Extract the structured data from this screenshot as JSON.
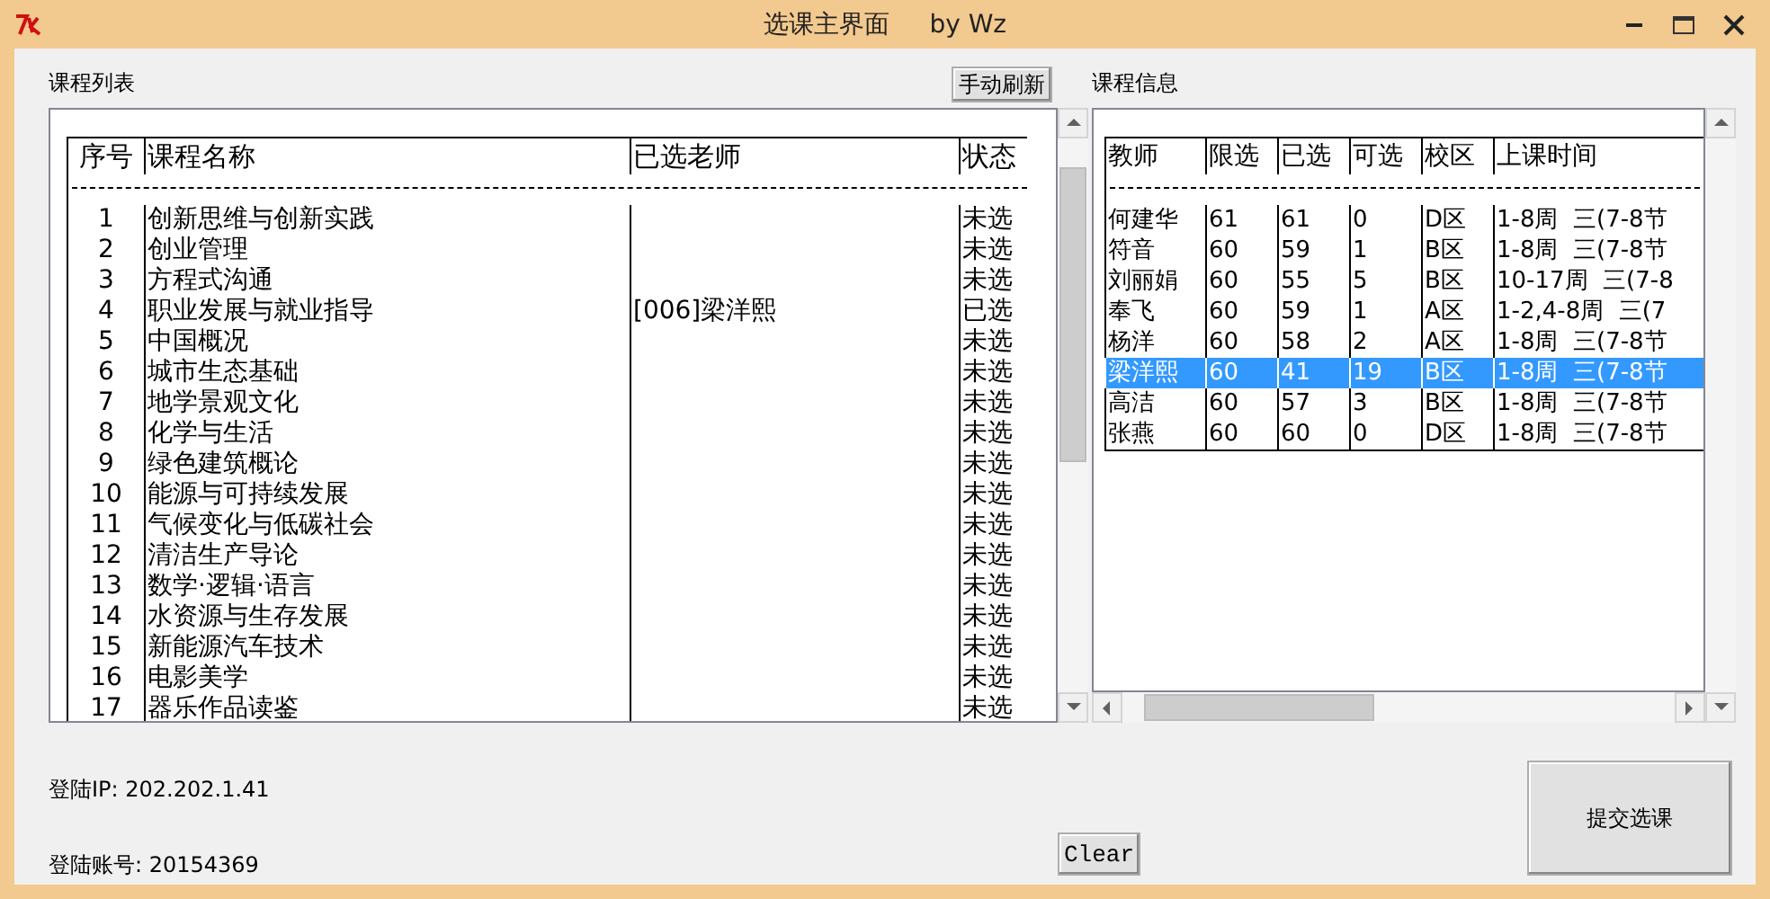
{
  "window": {
    "title": "选课主界面     by Wz"
  },
  "course_list": {
    "label": "课程列表",
    "refresh_button": "手动刷新",
    "columns": [
      "序号",
      "课程名称",
      "已选老师",
      "状态"
    ],
    "rows": [
      {
        "cells": [
          "1",
          "创新思维与创新实践",
          "",
          "未选"
        ]
      },
      {
        "cells": [
          "2",
          "创业管理",
          "",
          "未选"
        ]
      },
      {
        "cells": [
          "3",
          "方程式沟通",
          "",
          "未选"
        ]
      },
      {
        "cells": [
          "4",
          "职业发展与就业指导",
          "[006]梁洋熙",
          "已选"
        ]
      },
      {
        "cells": [
          "5",
          "中国概况",
          "",
          "未选"
        ]
      },
      {
        "cells": [
          "6",
          "城市生态基础",
          "",
          "未选"
        ]
      },
      {
        "cells": [
          "7",
          "地学景观文化",
          "",
          "未选"
        ]
      },
      {
        "cells": [
          "8",
          "化学与生活",
          "",
          "未选"
        ]
      },
      {
        "cells": [
          "9",
          "绿色建筑概论",
          "",
          "未选"
        ]
      },
      {
        "cells": [
          "10",
          "能源与可持续发展",
          "",
          "未选"
        ]
      },
      {
        "cells": [
          "11",
          "气候变化与低碳社会",
          "",
          "未选"
        ]
      },
      {
        "cells": [
          "12",
          "清洁生产导论",
          "",
          "未选"
        ]
      },
      {
        "cells": [
          "13",
          "数学·逻辑·语言",
          "",
          "未选"
        ]
      },
      {
        "cells": [
          "14",
          "水资源与生存发展",
          "",
          "未选"
        ]
      },
      {
        "cells": [
          "15",
          "新能源汽车技术",
          "",
          "未选"
        ]
      },
      {
        "cells": [
          "16",
          "电影美学",
          "",
          "未选"
        ]
      },
      {
        "cells": [
          "17",
          "器乐作品读鉴",
          "",
          "未选"
        ]
      }
    ]
  },
  "course_info": {
    "label": "课程信息",
    "columns": [
      "教师",
      "限选",
      "已选",
      "可选",
      "校区",
      "上课时间"
    ],
    "rows": [
      {
        "cells": [
          "何建华",
          "61",
          "61",
          "0",
          "D区",
          "1-8周  三(7-8节"
        ],
        "selected": false
      },
      {
        "cells": [
          "符音",
          "60",
          "59",
          "1",
          "B区",
          "1-8周  三(7-8节"
        ],
        "selected": false
      },
      {
        "cells": [
          "刘丽娟",
          "60",
          "55",
          "5",
          "B区",
          "10-17周  三(7-8"
        ],
        "selected": false
      },
      {
        "cells": [
          "奉飞",
          "60",
          "59",
          "1",
          "A区",
          "1-2,4-8周  三(7"
        ],
        "selected": false
      },
      {
        "cells": [
          "杨洋",
          "60",
          "58",
          "2",
          "A区",
          "1-8周  三(7-8节"
        ],
        "selected": false
      },
      {
        "cells": [
          "梁洋熙",
          "60",
          "41",
          "19",
          "B区",
          "1-8周  三(7-8节"
        ],
        "selected": true
      },
      {
        "cells": [
          "高洁",
          "60",
          "57",
          "3",
          "B区",
          "1-8周  三(7-8节"
        ],
        "selected": false
      },
      {
        "cells": [
          "张燕",
          "60",
          "60",
          "0",
          "D区",
          "1-8周  三(7-8节"
        ],
        "selected": false
      }
    ]
  },
  "footer": {
    "login_ip": "登陆IP: 202.202.1.41",
    "login_account": "登陆账号: 20154369",
    "clear_button": "Clear",
    "submit_button": "提交选课"
  }
}
